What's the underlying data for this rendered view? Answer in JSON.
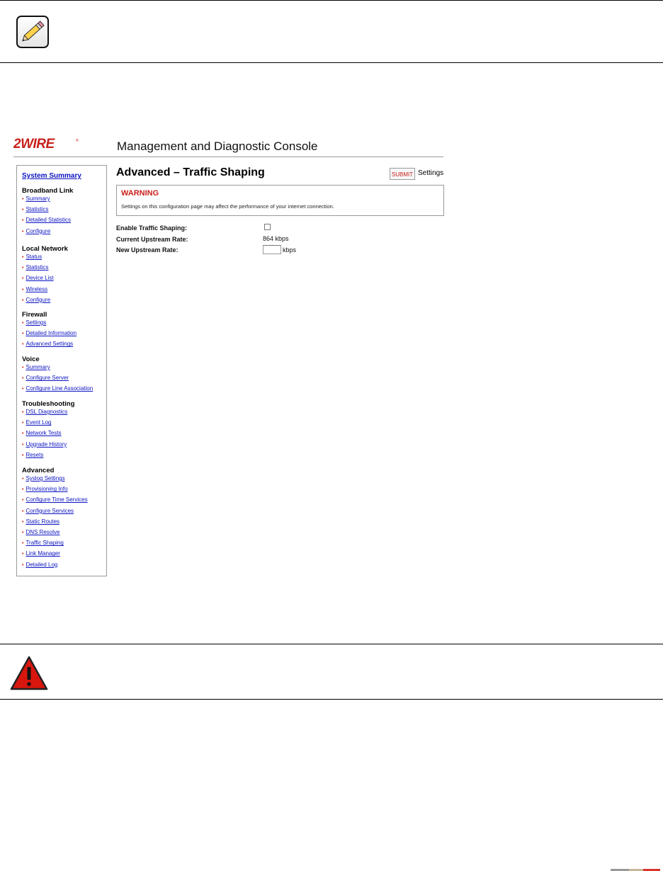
{
  "app": {
    "logo_text": "2WIRE",
    "console_title": "Management and Diagnostic Console"
  },
  "sidebar": {
    "summary_link": "System Summary",
    "sections": [
      {
        "heading": "Broadband Link",
        "items": [
          "Summary",
          "Statistics",
          "Detailed Statistics",
          "Configure"
        ]
      },
      {
        "heading": "Local Network",
        "items": [
          "Status",
          "Statistics",
          "Device List",
          "Wireless",
          "Configure"
        ]
      },
      {
        "heading": "Firewall",
        "items": [
          "Settings",
          "Detailed Information",
          "Advanced Settings"
        ]
      },
      {
        "heading": "Voice",
        "items": [
          "Summary",
          "Configure Server",
          "Configure Line Association"
        ]
      },
      {
        "heading": "Troubleshooting",
        "items": [
          "DSL Diagnostics",
          "Event Log",
          "Network Tests",
          "Upgrade History",
          "Resets"
        ]
      },
      {
        "heading": "Advanced",
        "items": [
          "Syslog Settings",
          "Provisioning Info",
          "Configure Time Services",
          "Configure Services",
          "Static Routes",
          "DNS Resolve",
          "Traffic Shaping",
          "Link Manager",
          "Detailed Log"
        ]
      }
    ]
  },
  "main": {
    "heading": "Advanced – Traffic Shaping",
    "submit_label": "SUBMIT",
    "submit_suffix": "Settings",
    "warning": {
      "title": "WARNING",
      "text": "Settings on this configuration page may affect the performance of your internet connection."
    },
    "form": {
      "enable_label": "Enable Traffic Shaping:",
      "enable_checked": false,
      "current_label": "Current Upstream Rate:",
      "current_value": "864 kbps",
      "new_label": "New Upstream Rate:",
      "new_value": "",
      "new_unit": "kbps"
    }
  },
  "icons": {
    "note": "pencil-icon",
    "warning": "warning-triangle-icon"
  },
  "colors": {
    "brand_red": "#c8201a",
    "link_blue": "#0b14c2",
    "bullet_red": "#d0180b"
  }
}
